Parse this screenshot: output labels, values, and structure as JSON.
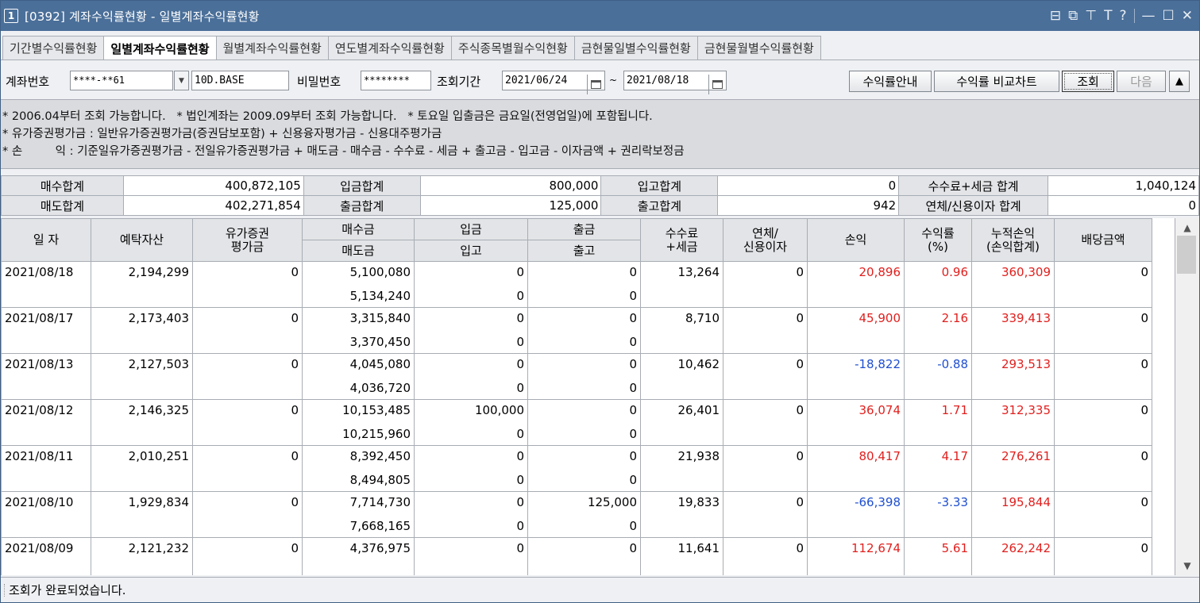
{
  "window": {
    "number": "1",
    "title": "[0392] 계좌수익률현황 - 일별계좌수익률현황",
    "tools": [
      "layout-icon",
      "window-icon",
      "pin-icon",
      "T",
      "?",
      "minimize-icon",
      "maximize-icon",
      "close-icon"
    ]
  },
  "tabs": [
    {
      "label": "기간별수익률현황",
      "active": false
    },
    {
      "label": "일별계좌수익률현황",
      "active": true
    },
    {
      "label": "월별계좌수익률현황",
      "active": false
    },
    {
      "label": "연도별계좌수익률현황",
      "active": false
    },
    {
      "label": "주식종목별월수익현황",
      "active": false
    },
    {
      "label": "금현물일별수익률현황",
      "active": false
    },
    {
      "label": "금현물월별수익률현황",
      "active": false
    }
  ],
  "search": {
    "account_label": "계좌번호",
    "account_value": "****-**61",
    "account_name": "10D.BASE",
    "password_label": "비밀번호",
    "password_value": "********",
    "period_label": "조회기간",
    "start_date": "2021/06/24",
    "tilde": "~",
    "end_date": "2021/08/18",
    "btn_guide": "수익률안내",
    "btn_chart": "수익률 비교차트",
    "btn_query": "조회",
    "btn_next": "다음",
    "btn_collapse": "▲"
  },
  "info": {
    "line1": "* 2006.04부터 조회 가능합니다.   * 법인계좌는 2009.09부터 조회 가능합니다.   * 토요일 입출금은 금요일(전영업일)에 포함됩니다.",
    "line2": "* 유가증권평가금 : 일반유가증권평가금(증권담보포함) + 신용융자평가금 - 신용대주평가금",
    "line3": "* 손         익 : 기준일유가증권평가금 - 전일유가증권평가금 + 매도금 - 매수금 - 수수료 - 세금 + 출고금 - 입고금 - 이자금액 + 권리락보정금"
  },
  "summary": {
    "row1": [
      {
        "label": "매수합계",
        "value": "400,872,105"
      },
      {
        "label": "입금합계",
        "value": "800,000"
      },
      {
        "label": "입고합계",
        "value": "0"
      },
      {
        "label": "수수료+세금 합계",
        "value": "1,040,124"
      }
    ],
    "row2": [
      {
        "label": "매도합계",
        "value": "402,271,854"
      },
      {
        "label": "출금합계",
        "value": "125,000"
      },
      {
        "label": "출고합계",
        "value": "942"
      },
      {
        "label": "연체/신용이자 합계",
        "value": "0"
      }
    ]
  },
  "grid": {
    "headers": {
      "date": "일 자",
      "deposit_assets": "예탁자산",
      "securities_eval": "유가증권\n평가금",
      "buy": "매수금",
      "sell": "매도금",
      "deposit": "입금",
      "stock_in": "입고",
      "withdraw": "출금",
      "stock_out": "출고",
      "fee_tax": "수수료\n+세금",
      "overdue_interest": "연체/\n신용이자",
      "pnl": "손익",
      "return_rate": "수익률\n(%)",
      "cum_pnl": "누적손익\n(손익합계)",
      "dividend": "배당금액"
    },
    "rows": [
      {
        "date": "2021/08/18",
        "assets": "2,194,299",
        "sec": "0",
        "buy": "5,100,080",
        "sell": "5,134,240",
        "dep": "0",
        "sin": "0",
        "wd": "0",
        "sout": "0",
        "fee": "13,264",
        "int": "0",
        "pnl": "20,896",
        "rate": "0.96",
        "cum": "360,309",
        "div": "0",
        "sign": "pos"
      },
      {
        "date": "2021/08/17",
        "assets": "2,173,403",
        "sec": "0",
        "buy": "3,315,840",
        "sell": "3,370,450",
        "dep": "0",
        "sin": "0",
        "wd": "0",
        "sout": "0",
        "fee": "8,710",
        "int": "0",
        "pnl": "45,900",
        "rate": "2.16",
        "cum": "339,413",
        "div": "0",
        "sign": "pos"
      },
      {
        "date": "2021/08/13",
        "assets": "2,127,503",
        "sec": "0",
        "buy": "4,045,080",
        "sell": "4,036,720",
        "dep": "0",
        "sin": "0",
        "wd": "0",
        "sout": "0",
        "fee": "10,462",
        "int": "0",
        "pnl": "-18,822",
        "rate": "-0.88",
        "cum": "293,513",
        "div": "0",
        "sign": "neg"
      },
      {
        "date": "2021/08/12",
        "assets": "2,146,325",
        "sec": "0",
        "buy": "10,153,485",
        "sell": "10,215,960",
        "dep": "100,000",
        "sin": "0",
        "wd": "0",
        "sout": "0",
        "fee": "26,401",
        "int": "0",
        "pnl": "36,074",
        "rate": "1.71",
        "cum": "312,335",
        "div": "0",
        "sign": "pos"
      },
      {
        "date": "2021/08/11",
        "assets": "2,010,251",
        "sec": "0",
        "buy": "8,392,450",
        "sell": "8,494,805",
        "dep": "0",
        "sin": "0",
        "wd": "0",
        "sout": "0",
        "fee": "21,938",
        "int": "0",
        "pnl": "80,417",
        "rate": "4.17",
        "cum": "276,261",
        "div": "0",
        "sign": "pos"
      },
      {
        "date": "2021/08/10",
        "assets": "1,929,834",
        "sec": "0",
        "buy": "7,714,730",
        "sell": "7,668,165",
        "dep": "0",
        "sin": "0",
        "wd": "125,000",
        "sout": "0",
        "fee": "19,833",
        "int": "0",
        "pnl": "-66,398",
        "rate": "-3.33",
        "cum": "195,844",
        "div": "0",
        "sign": "neg"
      },
      {
        "date": "2021/08/09",
        "assets": "2,121,232",
        "sec": "0",
        "buy": "4,376,975",
        "sell": "",
        "dep": "0",
        "sin": "",
        "wd": "0",
        "sout": "",
        "fee": "11,641",
        "int": "0",
        "pnl": "112,674",
        "rate": "5.61",
        "cum": "262,242",
        "div": "0",
        "sign": "pos"
      }
    ]
  },
  "status": {
    "message": "조회가 완료되었습니다."
  }
}
